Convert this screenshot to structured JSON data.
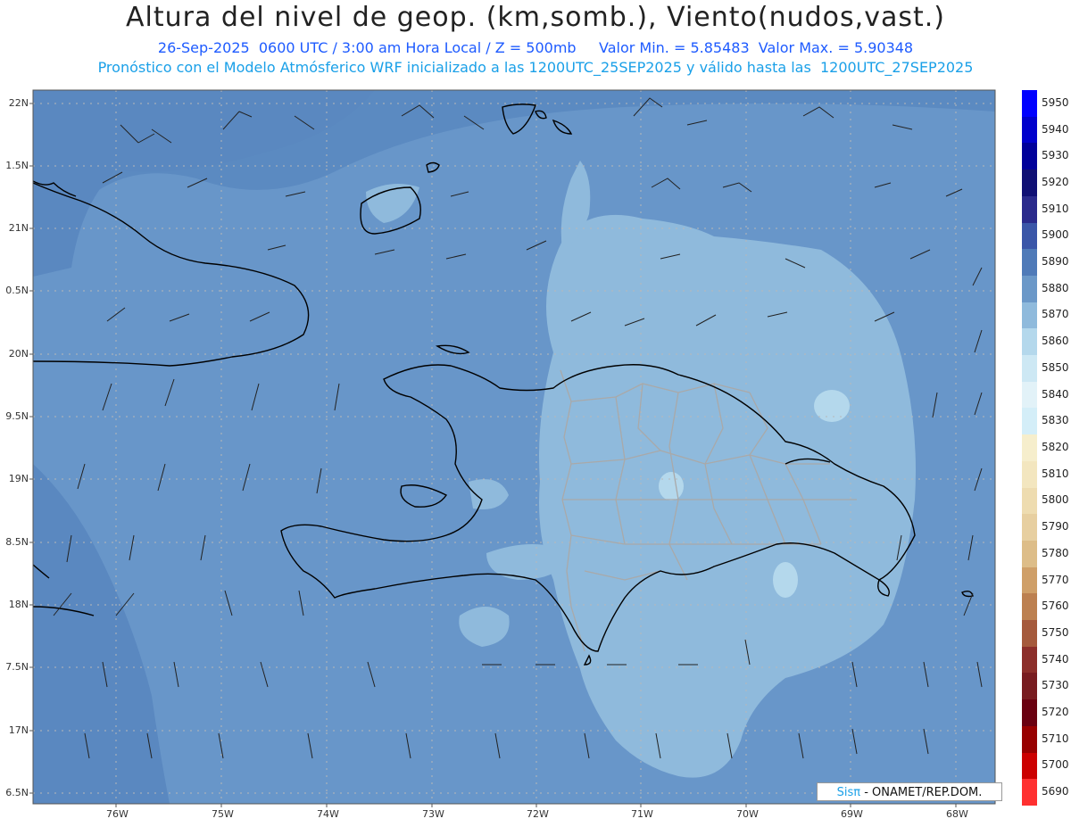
{
  "header": {
    "title": "Altura del nivel de geop. (km,somb.), Viento(nudos,vast.)",
    "subtitle_line1": "26-Sep-2025  0600 UTC / 3:00 am Hora Local / Z = 500mb     Valor Min. = 5.85483  Valor Max. = 5.90348",
    "subtitle_line2": "Pronóstico con el Modelo Atmósferico WRF inicializado a las 1200UTC_25SEP2025 y válido hasta las  1200UTC_27SEP2025"
  },
  "axes": {
    "lat_labels": [
      "22N",
      "1.5N",
      "21N",
      "0.5N",
      "20N",
      "9.5N",
      "19N",
      "8.5N",
      "18N",
      "7.5N",
      "17N",
      "6.5N"
    ],
    "lon_labels": [
      "76W",
      "75W",
      "74W",
      "73W",
      "72W",
      "71W",
      "70W",
      "69W",
      "68W"
    ]
  },
  "legend": {
    "labels": [
      "5950",
      "5940",
      "5930",
      "5920",
      "5910",
      "5900",
      "5890",
      "5880",
      "5870",
      "5860",
      "5850",
      "5840",
      "5830",
      "5820",
      "5810",
      "5800",
      "5790",
      "5780",
      "5770",
      "5760",
      "5750",
      "5740",
      "5730",
      "5720",
      "5710",
      "5700",
      "5690"
    ],
    "colors": [
      "#0000ff",
      "#0000cc",
      "#00009a",
      "#101074",
      "#2a2a8c",
      "#3a56a8",
      "#4f7ab8",
      "#6b98c8",
      "#8fbadc",
      "#b4d8ec",
      "#cde8f4",
      "#e2f2f8",
      "#d4eef8",
      "#f6eecc",
      "#f3e6bf",
      "#eedcb0",
      "#e7cfa0",
      "#ddbd88",
      "#cf9f68",
      "#bc8050",
      "#a55a3c",
      "#8c2e2a",
      "#781c20",
      "#6a0010",
      "#980000",
      "#cc0000",
      "#ff3030"
    ]
  },
  "map_colors": {
    "sea_dark": "#5f8ec5",
    "sea_mid": "#6b98cb",
    "land_contour": "#8fbadc",
    "light_patch": "#b4d8ec",
    "coast": "#000000",
    "provinces": "#a9a9a9"
  },
  "credit": {
    "sis": "Sis",
    "pi": "π",
    "rest": "- ONAMET/REP.DOM."
  }
}
